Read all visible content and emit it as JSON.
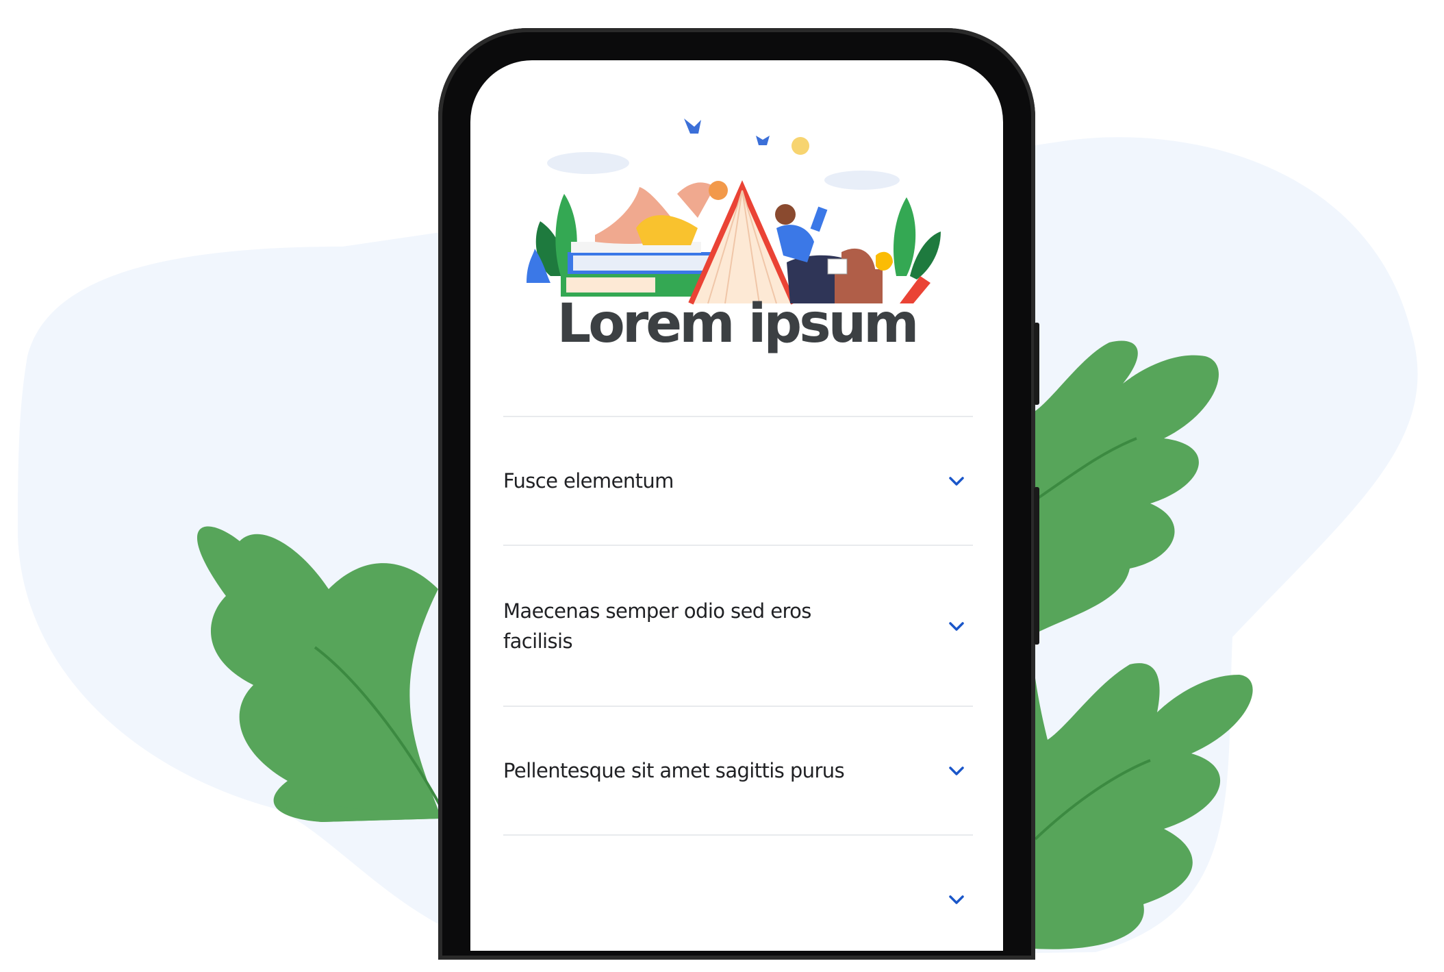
{
  "page": {
    "title": "Lorem ipsum"
  },
  "accordion": {
    "items": [
      {
        "label": "Fusce elementum",
        "icon": "chevron-down-icon"
      },
      {
        "label": "Maecenas semper odio sed eros facilisis",
        "icon": "chevron-down-icon"
      },
      {
        "label": "Pellentesque sit amet sagittis purus",
        "icon": "chevron-down-icon"
      },
      {
        "label": "",
        "icon": "chevron-down-icon"
      }
    ]
  },
  "colors": {
    "background_blob": "#f1f6fd",
    "leaf": "#57a55a",
    "leaf_vein": "#3c8a41",
    "phone_frame": "#0b0b0c",
    "title_text": "#3c4043",
    "item_text": "#202124",
    "chevron": "#1a56c9",
    "divider": "#e8eaed"
  }
}
